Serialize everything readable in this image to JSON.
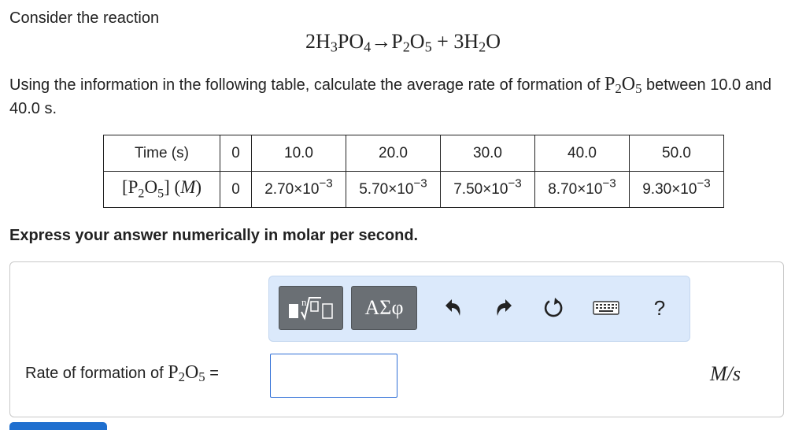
{
  "intro": "Consider the reaction",
  "equation": {
    "reactant_coef": "2",
    "reactant_1": "H",
    "reactant_1_sub": "3",
    "reactant_2": "PO",
    "reactant_2_sub": "4",
    "arrow": "→",
    "product_1": "P",
    "product_1_sub": "2",
    "product_2": "O",
    "product_2_sub": "5",
    "plus": " + ",
    "product_coef": "3",
    "product_3": "H",
    "product_3_sub": "2",
    "product_4": "O"
  },
  "question": {
    "text_before": "Using the information in the following table, calculate the average rate of formation of ",
    "formula_p": "P",
    "formula_p_sub": "2",
    "formula_o": "O",
    "formula_o_sub": "5",
    "text_after": " between 10.0 and 40.0 s."
  },
  "table": {
    "row1_header": "Time (s)",
    "times": [
      "0",
      "10.0",
      "20.0",
      "30.0",
      "40.0",
      "50.0"
    ],
    "row2_header": {
      "bracket_open": "[",
      "p": "P",
      "p_sub": "2",
      "o": "O",
      "o_sub": "5",
      "bracket_close": "]",
      "unit_open": " (",
      "unit": "M",
      "unit_close": ")"
    },
    "concentrations": [
      {
        "mantissa": "0",
        "exponent": ""
      },
      {
        "mantissa": "2.70×10",
        "exponent": "−3"
      },
      {
        "mantissa": "5.70×10",
        "exponent": "−3"
      },
      {
        "mantissa": "7.50×10",
        "exponent": "−3"
      },
      {
        "mantissa": "8.70×10",
        "exponent": "−3"
      },
      {
        "mantissa": "9.30×10",
        "exponent": "−3"
      }
    ]
  },
  "instruction": "Express your answer numerically in molar per second.",
  "toolbar": {
    "templates_icon": "templates-icon",
    "symbols_label": "ΑΣφ",
    "undo_icon": "undo-icon",
    "redo_icon": "redo-icon",
    "reset_icon": "reset-icon",
    "keyboard_icon": "keyboard-icon",
    "help_label": "?"
  },
  "answer": {
    "label_before": "Rate of formation of ",
    "label_p": "P",
    "label_p_sub": "2",
    "label_o": "O",
    "label_o_sub": "5",
    "label_after": " =",
    "value": "",
    "units": "M/s"
  },
  "colors": {
    "toolbar_bg": "#dbe9fb",
    "button_gray": "#6a6f74",
    "input_border": "#2f6fd6",
    "submit_blue": "#1f6fcf"
  }
}
